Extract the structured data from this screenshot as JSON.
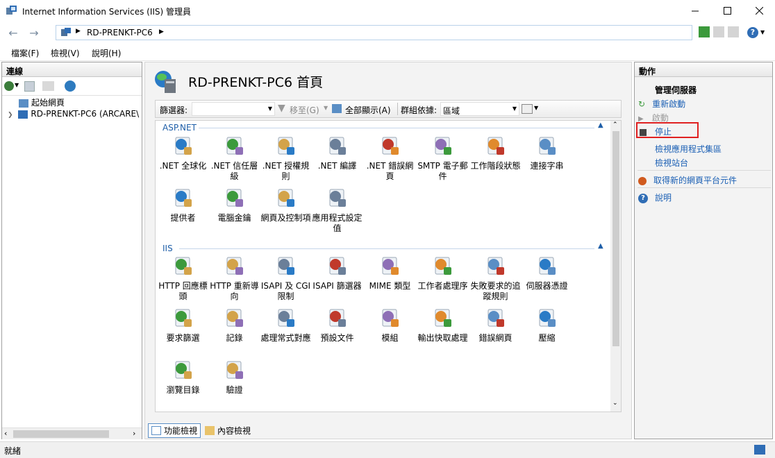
{
  "window": {
    "title": "Internet Information Services (IIS) 管理員"
  },
  "address": {
    "path": "RD-PRENKT-PC6"
  },
  "menu": [
    "檔案(F)",
    "檢視(V)",
    "說明(H)"
  ],
  "connections": {
    "title": "連線",
    "tree": [
      "起始網頁",
      "RD-PRENKT-PC6 (ARCARE\\"
    ]
  },
  "main": {
    "title": "RD-PRENKT-PC6 首頁",
    "filter_label": "篩選器:",
    "go_label": "移至(G)",
    "show_all": "全部顯示(A)",
    "group_label": "群組依據:",
    "group_value": "區域",
    "groups": [
      {
        "name": "ASP.NET",
        "features": [
          ".NET 全球化",
          ".NET 信任層級",
          ".NET 授權規則",
          ".NET 編譯",
          ".NET 錯誤網頁",
          "SMTP 電子郵件",
          "工作階段狀態",
          "連接字串",
          "提供者",
          "電腦金鑰",
          "網頁及控制項",
          "應用程式設定值"
        ]
      },
      {
        "name": "IIS",
        "features": [
          "HTTP 回應標頭",
          "HTTP 重新導向",
          "ISAPI 及 CGI 限制",
          "ISAPI 篩選器",
          "MIME 類型",
          "工作者處理序",
          "失敗要求的追蹤規則",
          "伺服器憑證",
          "要求篩選",
          "記錄",
          "處理常式對應",
          "預設文件",
          "模組",
          "輸出快取處理",
          "錯誤網頁",
          "壓縮",
          "瀏覽目錄",
          "驗證"
        ]
      }
    ],
    "tabs": [
      "功能檢視",
      "內容檢視"
    ]
  },
  "actions": {
    "title": "動作",
    "section": "管理伺服器",
    "items": [
      "重新啟動",
      "啟動",
      "停止",
      "檢視應用程式集區",
      "檢視站台",
      "取得新的網頁平台元件",
      "說明"
    ]
  },
  "status": {
    "text": "就緒"
  },
  "colors": {
    "accent": "#1a5fb4",
    "highlight_box": "#e02020",
    "group_header": "#1e5ea8"
  }
}
